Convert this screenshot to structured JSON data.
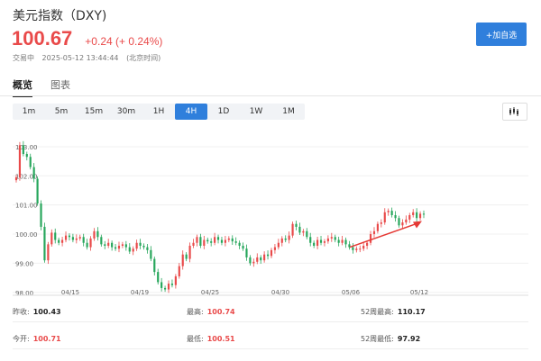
{
  "header": {
    "title": "美元指数（DXY)",
    "price": "100.67",
    "change": "+0.24 (+ 0.24%)",
    "status": "交易中",
    "datetime": "2025-05-12 13:44:44",
    "timezone": "(北京时间)",
    "add_button": "+加自选"
  },
  "tabs": [
    {
      "label": "概览",
      "active": true
    },
    {
      "label": "图表",
      "active": false
    }
  ],
  "ranges": [
    {
      "label": "1m",
      "active": false
    },
    {
      "label": "5m",
      "active": false
    },
    {
      "label": "15m",
      "active": false
    },
    {
      "label": "30m",
      "active": false
    },
    {
      "label": "1H",
      "active": false
    },
    {
      "label": "4H",
      "active": true
    },
    {
      "label": "1D",
      "active": false
    },
    {
      "label": "1W",
      "active": false
    },
    {
      "label": "1M",
      "active": false
    }
  ],
  "chart_type_icon": "candlestick-icon",
  "colors": {
    "up": "#e94a4a",
    "down": "#26a65b",
    "accent": "#2f7fdc",
    "annotation_arrow": "#e53935"
  },
  "chart_data": {
    "type": "candlestick",
    "y_ticks": [
      "103.00",
      "102.00",
      "101.00",
      "100.00",
      "99.00",
      "98.00"
    ],
    "x_ticks": [
      "04/15",
      "04/19",
      "04/25",
      "04/30",
      "05/06",
      "05/12"
    ],
    "ylim": [
      97.9,
      103.4
    ],
    "closes": [
      101.95,
      103.05,
      102.75,
      102.65,
      102.3,
      101.9,
      101.05,
      100.25,
      99.1,
      99.65,
      100.05,
      99.8,
      99.7,
      99.8,
      99.95,
      99.9,
      99.8,
      99.85,
      99.9,
      99.7,
      99.55,
      99.85,
      100.1,
      99.9,
      99.65,
      99.6,
      99.7,
      99.55,
      99.5,
      99.6,
      99.65,
      99.55,
      99.4,
      99.5,
      99.7,
      99.6,
      99.55,
      99.45,
      99.15,
      98.7,
      98.35,
      98.15,
      98.1,
      98.3,
      98.25,
      98.55,
      98.9,
      99.3,
      99.15,
      99.6,
      99.7,
      99.9,
      99.6,
      99.8,
      99.75,
      99.7,
      99.9,
      99.8,
      99.7,
      99.8,
      99.85,
      99.75,
      99.7,
      99.6,
      99.5,
      99.2,
      99.0,
      99.05,
      99.2,
      99.1,
      99.3,
      99.25,
      99.45,
      99.55,
      99.7,
      99.85,
      99.8,
      99.95,
      100.35,
      100.25,
      100.05,
      100.1,
      99.9,
      99.7,
      99.6,
      99.8,
      99.7,
      99.75,
      99.85,
      99.9,
      99.8,
      99.7,
      99.8,
      99.65,
      99.55,
      99.45,
      99.5,
      99.5,
      99.6,
      99.7,
      100.0,
      100.1,
      100.35,
      100.4,
      100.75,
      100.8,
      100.65,
      100.55,
      100.3,
      100.4,
      100.5,
      100.65,
      100.75,
      100.55,
      100.7,
      100.67
    ],
    "annotation": "red-arrow-up"
  },
  "stats": {
    "row1": [
      {
        "label": "昨收:",
        "value": "100.43",
        "color": "dark"
      },
      {
        "label": "最高:",
        "value": "100.74",
        "color": "red"
      },
      {
        "label": "52周最高:",
        "value": "110.17",
        "color": "dark"
      }
    ],
    "row2": [
      {
        "label": "今开:",
        "value": "100.71",
        "color": "red"
      },
      {
        "label": "最低:",
        "value": "100.51",
        "color": "red"
      },
      {
        "label": "52周最低:",
        "value": "97.92",
        "color": "dark"
      }
    ]
  }
}
